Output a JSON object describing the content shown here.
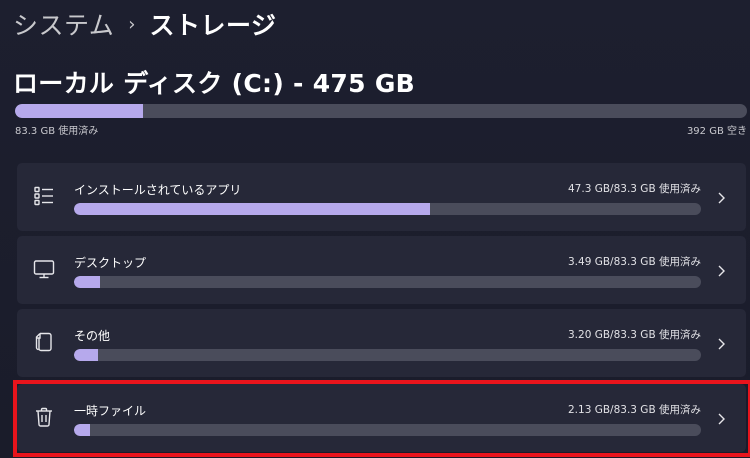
{
  "breadcrumb": {
    "parent": "システム",
    "separator": "›",
    "current": "ストレージ"
  },
  "disk": {
    "title": "ローカル ディスク (C:) - 475 GB",
    "used_label": "83.3 GB 使用済み",
    "free_label": "392 GB 空き",
    "used_fraction": 0.175
  },
  "categories": [
    {
      "label": "インストールされているアプリ",
      "usage": "47.3 GB/83.3 GB 使用済み",
      "fraction": 0.568,
      "icon": "apps-list-icon"
    },
    {
      "label": "デスクトップ",
      "usage": "3.49 GB/83.3 GB 使用済み",
      "fraction": 0.042,
      "icon": "monitor-icon"
    },
    {
      "label": "その他",
      "usage": "3.20 GB/83.3 GB 使用済み",
      "fraction": 0.038,
      "icon": "document-icon"
    },
    {
      "label": "一時ファイル",
      "usage": "2.13 GB/83.3 GB 使用済み",
      "fraction": 0.026,
      "icon": "trash-icon"
    }
  ],
  "colors": {
    "accent": "#b6a9ec",
    "track": "#4a4c5b",
    "highlight": "#e8141c"
  }
}
